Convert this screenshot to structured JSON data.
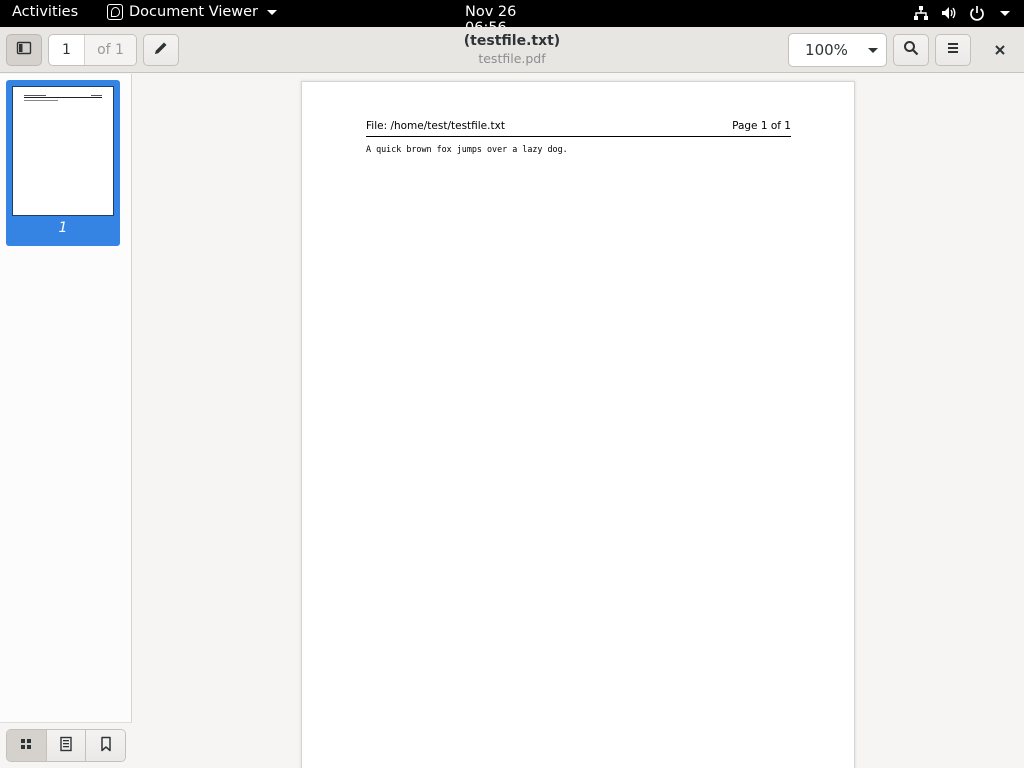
{
  "topbar": {
    "activities": "Activities",
    "app_name": "Document Viewer",
    "clock": "Nov 26  06:56"
  },
  "header": {
    "page_current": "1",
    "page_total": "of 1",
    "title": "(testfile.txt)",
    "subtitle": "testfile.pdf",
    "zoom": "100%"
  },
  "sidebar": {
    "thumbnails": [
      {
        "page_label": "1",
        "selected": true
      }
    ],
    "tabs": [
      {
        "name": "thumbnails",
        "icon": "grid-icon",
        "active": true
      },
      {
        "name": "outline",
        "icon": "document-icon",
        "active": false
      },
      {
        "name": "bookmarks",
        "icon": "bookmark-icon",
        "active": false
      }
    ]
  },
  "document": {
    "header_left": "File: /home/test/testfile.txt",
    "header_right": "Page 1 of 1",
    "body": "A quick brown fox jumps over a lazy dog."
  },
  "colors": {
    "accent": "#3584e4",
    "topbar": "#000000",
    "headerbar": "#e8e6e3"
  }
}
